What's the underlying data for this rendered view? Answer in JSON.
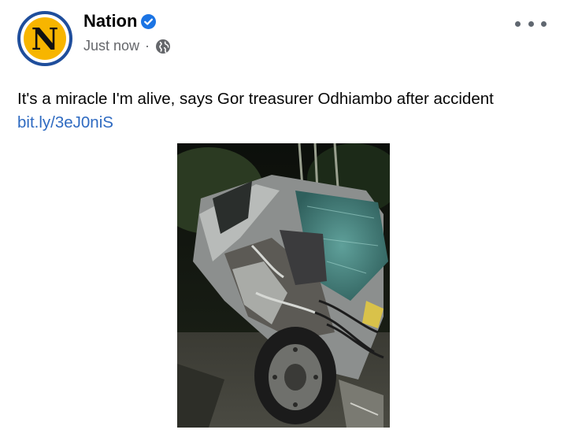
{
  "post": {
    "page_name": "Nation",
    "avatar_letter": "N",
    "timestamp": "Just now",
    "separator": "·",
    "audience_icon": "globe-icon",
    "verified_icon": "verified-badge-icon",
    "more_icon": "more-options-icon",
    "text": "It's a miracle I'm alive, says Gor treasurer Odhiambo after accident",
    "link": "bit.ly/3eJ0niS",
    "image_icon": "car-wreck-photo"
  },
  "colors": {
    "avatar_ring": "#1f4e9c",
    "avatar_fill": "#f7b500",
    "link": "#2e6ac1",
    "verified": "#1b74e4",
    "meta_text": "#65676b"
  }
}
